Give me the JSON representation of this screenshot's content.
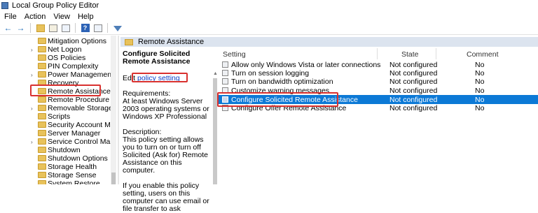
{
  "window": {
    "title": "Local Group Policy Editor"
  },
  "menu": [
    "File",
    "Action",
    "View",
    "Help"
  ],
  "tree": {
    "items": [
      {
        "label": "Mitigation Options",
        "expander": false
      },
      {
        "label": "Net Logon",
        "expander": true
      },
      {
        "label": "OS Policies",
        "expander": false
      },
      {
        "label": "PIN Complexity",
        "expander": false
      },
      {
        "label": "Power Management",
        "expander": true
      },
      {
        "label": "Recovery",
        "expander": false
      },
      {
        "label": "Remote Assistance",
        "expander": false,
        "selected": true
      },
      {
        "label": "Remote Procedure Call",
        "expander": false
      },
      {
        "label": "Removable Storage Acces",
        "expander": true
      },
      {
        "label": "Scripts",
        "expander": false
      },
      {
        "label": "Security Account Manage",
        "expander": false
      },
      {
        "label": "Server Manager",
        "expander": false
      },
      {
        "label": "Service Control Manager",
        "expander": true
      },
      {
        "label": "Shutdown",
        "expander": false
      },
      {
        "label": "Shutdown Options",
        "expander": false
      },
      {
        "label": "Storage Health",
        "expander": false
      },
      {
        "label": "Storage Sense",
        "expander": false
      },
      {
        "label": "System Restore",
        "expander": false
      }
    ]
  },
  "description": {
    "header": "Remote Assistance",
    "title": "Configure Solicited Remote Assistance",
    "edit_prefix": "Edit",
    "edit_link": "policy setting",
    "requirements_label": "Requirements:",
    "requirements_text": "At least Windows Server 2003 operating systems or Windows XP Professional",
    "description_label": "Description:",
    "description_text": "This policy setting allows you to turn on or turn off Solicited (Ask for) Remote Assistance on this computer.",
    "more_text": "If you enable this policy setting, users on this computer can use email or file transfer to ask"
  },
  "list": {
    "columns": {
      "setting": "Setting",
      "state": "State",
      "comment": "Comment"
    },
    "rows": [
      {
        "setting": "Allow only Windows Vista or later connections",
        "state": "Not configured",
        "comment": "No"
      },
      {
        "setting": "Turn on session logging",
        "state": "Not configured",
        "comment": "No"
      },
      {
        "setting": "Turn on bandwidth optimization",
        "state": "Not configured",
        "comment": "No"
      },
      {
        "setting": "Customize warning messages",
        "state": "Not configured",
        "comment": "No"
      },
      {
        "setting": "Configure Solicited Remote Assistance",
        "state": "Not configured",
        "comment": "No",
        "selected": true
      },
      {
        "setting": "Configure Offer Remote Assistance",
        "state": "Not configured",
        "comment": "No"
      }
    ]
  },
  "colors": {
    "selection": "#0c79d6",
    "highlight": "#d9312f",
    "link": "#0b40c9"
  }
}
